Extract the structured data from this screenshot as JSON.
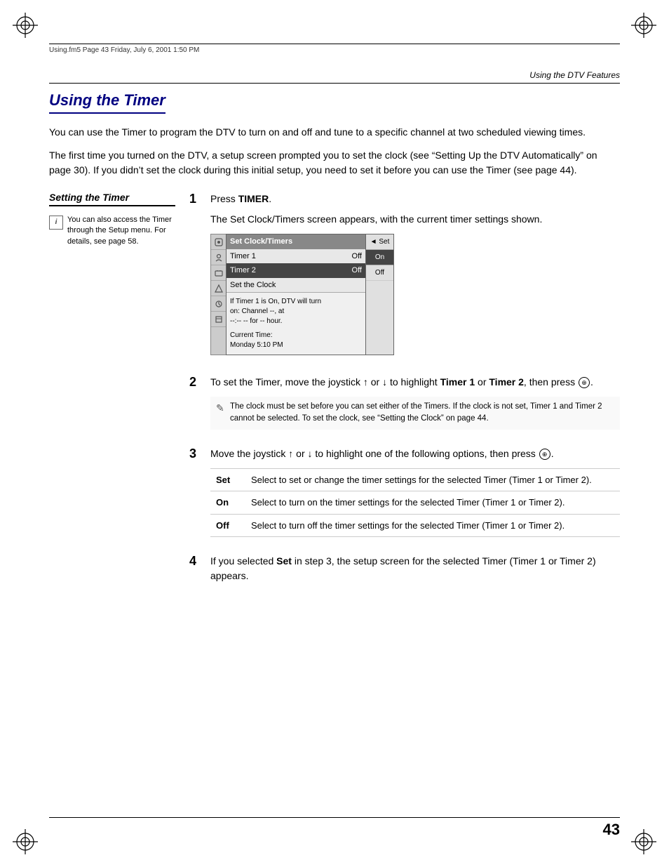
{
  "meta": {
    "file_info": "Using.fm5  Page 43  Friday, July 6, 2001  1:50 PM",
    "page_number": "43",
    "header_title": "Using the DTV Features"
  },
  "section": {
    "title": "Using the Timer",
    "intro_p1": "You can use the Timer to program the DTV to turn on and off and tune to a specific channel at two scheduled viewing times.",
    "intro_p2": "The first time you turned on the DTV, a setup screen prompted you to set the clock (see “Setting Up the DTV Automatically” on page 30). If you didn’t set the clock during this initial setup, you need to set it before you can use the Timer (see page 44)."
  },
  "sidebar": {
    "subsection_title": "Setting the Timer",
    "tip_icon_label": "i",
    "tip_text": "You can also access the Timer through the Setup menu. For details, see page 58."
  },
  "steps": [
    {
      "num": "1",
      "text": "Press TIMER.",
      "sub_text": "The Set Clock/Timers screen appears, with the current timer settings shown."
    },
    {
      "num": "2",
      "text": "To set the Timer, move the joystick ↑ or ↓ to highlight Timer 1 or Timer 2, then press ⓔ.",
      "note": "The clock must be set before you can set either of the Timers. If the clock is not set, Timer 1 and Timer 2 cannot be selected. To set the clock, see “Setting the Clock” on page 44."
    },
    {
      "num": "3",
      "text": "Move the joystick ↑ or ↓ to highlight one of the following options, then press ⓔ.",
      "options": [
        {
          "label": "Set",
          "description": "Select to set or change the timer settings for the selected Timer (Timer 1 or Timer 2)."
        },
        {
          "label": "On",
          "description": "Select to turn on the timer settings for the selected Timer (Timer 1 or Timer 2)."
        },
        {
          "label": "Off",
          "description": "Select to turn off the timer settings for the selected Timer (Timer 1 or Timer 2)."
        }
      ]
    },
    {
      "num": "4",
      "text": "If you selected Set in step 3, the setup screen for the selected Timer (Timer 1 or Timer 2) appears."
    }
  ],
  "screen_mockup": {
    "title": "Set Clock/Timers",
    "rows": [
      {
        "label": "Timer 1",
        "value": "Off",
        "selected": false
      },
      {
        "label": "Timer 2",
        "value": "Off",
        "selected": true
      },
      {
        "label": "Set the Clock",
        "value": "",
        "selected": false
      }
    ],
    "sidebar_items": [
      "Set",
      "On",
      "Off"
    ],
    "info_lines": [
      "If Timer 1 is On, DTV will turn",
      "on: Channel --, at",
      "--:-- -- for -- hour.",
      "",
      "Current Time:",
      "Monday 5:10 PM"
    ]
  }
}
